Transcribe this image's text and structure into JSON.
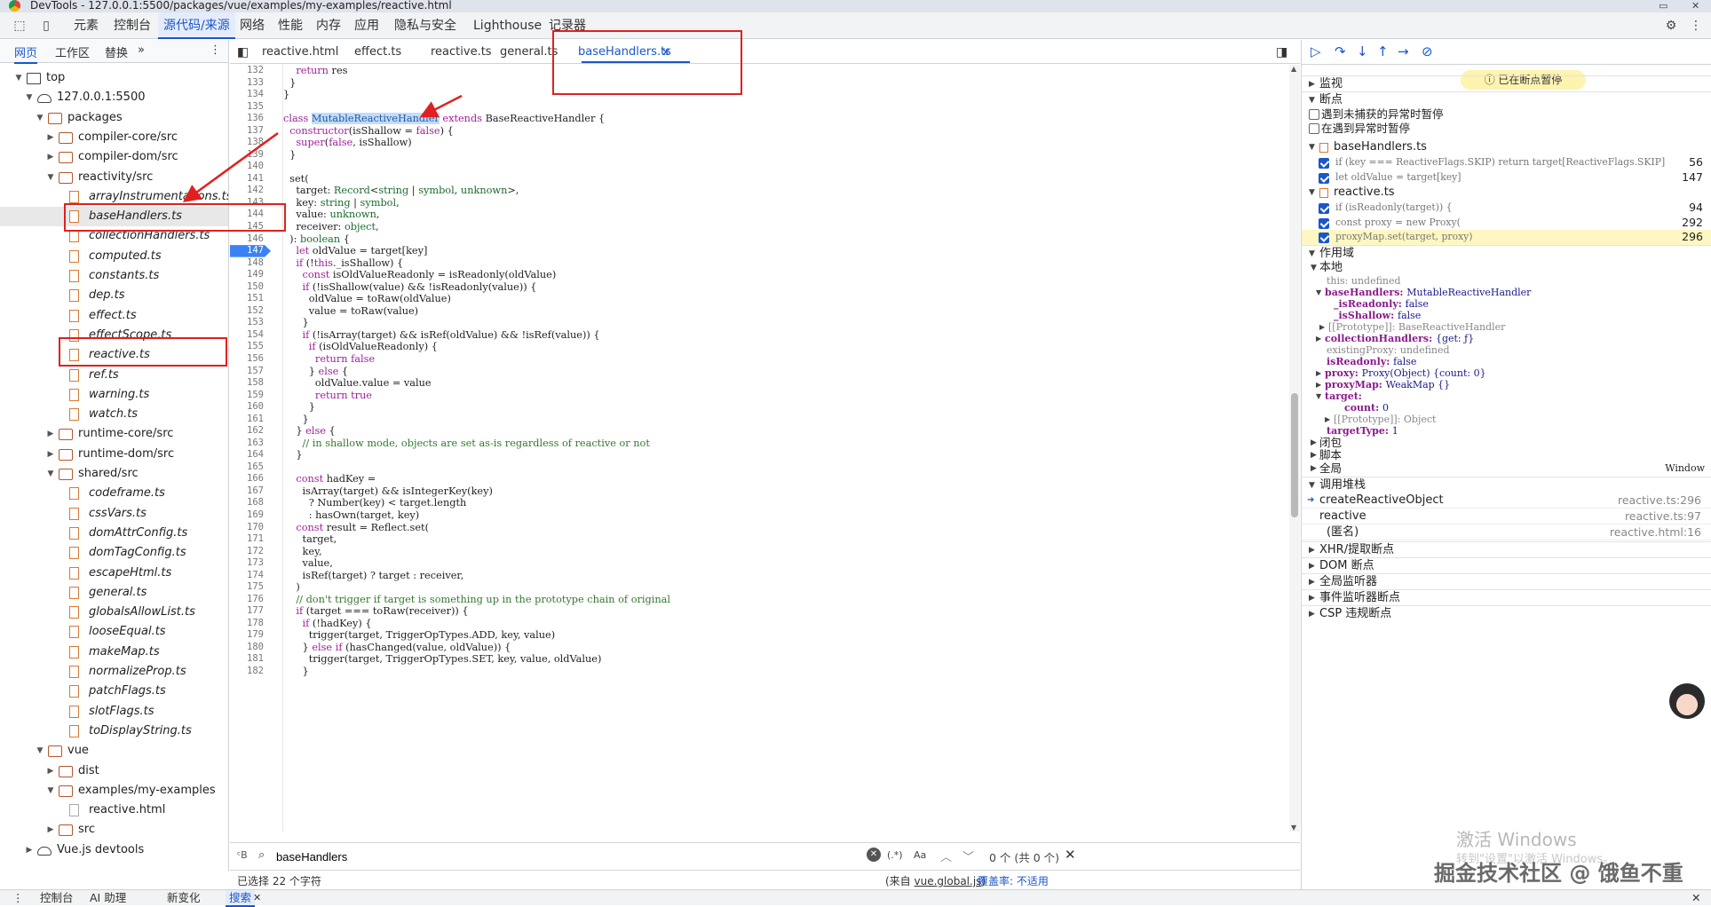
{
  "window": {
    "title": "DevTools - 127.0.0.1:5500/packages/vue/examples/my-examples/reactive.html"
  },
  "main_tabs": [
    "元素",
    "控制台",
    "源代码/来源",
    "网络",
    "性能",
    "内存",
    "应用",
    "隐私与安全",
    "Lighthouse",
    "记录器"
  ],
  "active_main_tab": "源代码/来源",
  "left_tabs": {
    "page": "网页",
    "workspace": "工作区",
    "overrides": "替换",
    "more": "»"
  },
  "file_tree": [
    {
      "label": "top",
      "depth": 0,
      "kind": "frame",
      "open": true
    },
    {
      "label": "127.0.0.1:5500",
      "depth": 1,
      "kind": "cloud",
      "open": true
    },
    {
      "label": "packages",
      "depth": 2,
      "kind": "folder",
      "open": true
    },
    {
      "label": "compiler-core/src",
      "depth": 3,
      "kind": "folder",
      "open": false
    },
    {
      "label": "compiler-dom/src",
      "depth": 3,
      "kind": "folder",
      "open": false
    },
    {
      "label": "reactivity/src",
      "depth": 3,
      "kind": "folder",
      "open": true
    },
    {
      "label": "arrayInstrumentations.ts",
      "depth": 4,
      "kind": "file"
    },
    {
      "label": "baseHandlers.ts",
      "depth": 4,
      "kind": "file",
      "selected": true
    },
    {
      "label": "collectionHandlers.ts",
      "depth": 4,
      "kind": "file"
    },
    {
      "label": "computed.ts",
      "depth": 4,
      "kind": "file"
    },
    {
      "label": "constants.ts",
      "depth": 4,
      "kind": "file"
    },
    {
      "label": "dep.ts",
      "depth": 4,
      "kind": "file"
    },
    {
      "label": "effect.ts",
      "depth": 4,
      "kind": "file"
    },
    {
      "label": "effectScope.ts",
      "depth": 4,
      "kind": "file"
    },
    {
      "label": "reactive.ts",
      "depth": 4,
      "kind": "file"
    },
    {
      "label": "ref.ts",
      "depth": 4,
      "kind": "file"
    },
    {
      "label": "warning.ts",
      "depth": 4,
      "kind": "file"
    },
    {
      "label": "watch.ts",
      "depth": 4,
      "kind": "file"
    },
    {
      "label": "runtime-core/src",
      "depth": 3,
      "kind": "folder",
      "open": false
    },
    {
      "label": "runtime-dom/src",
      "depth": 3,
      "kind": "folder",
      "open": false
    },
    {
      "label": "shared/src",
      "depth": 3,
      "kind": "folder",
      "open": true
    },
    {
      "label": "codeframe.ts",
      "depth": 4,
      "kind": "file"
    },
    {
      "label": "cssVars.ts",
      "depth": 4,
      "kind": "file"
    },
    {
      "label": "domAttrConfig.ts",
      "depth": 4,
      "kind": "file"
    },
    {
      "label": "domTagConfig.ts",
      "depth": 4,
      "kind": "file"
    },
    {
      "label": "escapeHtml.ts",
      "depth": 4,
      "kind": "file"
    },
    {
      "label": "general.ts",
      "depth": 4,
      "kind": "file"
    },
    {
      "label": "globalsAllowList.ts",
      "depth": 4,
      "kind": "file"
    },
    {
      "label": "looseEqual.ts",
      "depth": 4,
      "kind": "file"
    },
    {
      "label": "makeMap.ts",
      "depth": 4,
      "kind": "file"
    },
    {
      "label": "normalizeProp.ts",
      "depth": 4,
      "kind": "file"
    },
    {
      "label": "patchFlags.ts",
      "depth": 4,
      "kind": "file"
    },
    {
      "label": "slotFlags.ts",
      "depth": 4,
      "kind": "file"
    },
    {
      "label": "toDisplayString.ts",
      "depth": 4,
      "kind": "file"
    },
    {
      "label": "vue",
      "depth": 2,
      "kind": "folder",
      "open": true
    },
    {
      "label": "dist",
      "depth": 3,
      "kind": "folder",
      "open": false
    },
    {
      "label": "examples/my-examples",
      "depth": 3,
      "kind": "folder",
      "open": true
    },
    {
      "label": "reactive.html",
      "depth": 4,
      "kind": "htmlfile"
    },
    {
      "label": "src",
      "depth": 3,
      "kind": "folder",
      "open": false
    },
    {
      "label": "Vue.js devtools",
      "depth": 1,
      "kind": "cloud",
      "open": false
    }
  ],
  "editor_tabs": [
    "reactive.html",
    "effect.ts",
    "reactive.ts",
    "general.ts",
    "baseHandlers.ts"
  ],
  "active_editor_tab": "baseHandlers.ts",
  "code_lines": [
    {
      "n": "132",
      "t": "    return res"
    },
    {
      "n": "133",
      "t": "  }"
    },
    {
      "n": "134",
      "t": "}"
    },
    {
      "n": "135",
      "t": ""
    },
    {
      "n": "136",
      "t": "class MutableReactiveHandler extends BaseReactiveHandler {"
    },
    {
      "n": "137",
      "t": "  constructor(isShallow = false) {"
    },
    {
      "n": "138",
      "t": "    super(false, isShallow)"
    },
    {
      "n": "139",
      "t": "  }"
    },
    {
      "n": "140",
      "t": ""
    },
    {
      "n": "141",
      "t": "  set("
    },
    {
      "n": "142",
      "t": "    target: Record<string | symbol, unknown>,"
    },
    {
      "n": "143",
      "t": "    key: string | symbol,"
    },
    {
      "n": "144",
      "t": "    value: unknown,"
    },
    {
      "n": "145",
      "t": "    receiver: object,"
    },
    {
      "n": "146",
      "t": "  ): boolean {"
    },
    {
      "n": "147",
      "t": "    let oldValue = target[key]"
    },
    {
      "n": "148",
      "t": "    if (!this._isShallow) {"
    },
    {
      "n": "149",
      "t": "      const isOldValueReadonly = isReadonly(oldValue)"
    },
    {
      "n": "150",
      "t": "      if (!isShallow(value) && !isReadonly(value)) {"
    },
    {
      "n": "151",
      "t": "        oldValue = toRaw(oldValue)"
    },
    {
      "n": "152",
      "t": "        value = toRaw(value)"
    },
    {
      "n": "153",
      "t": "      }"
    },
    {
      "n": "154",
      "t": "      if (!isArray(target) && isRef(oldValue) && !isRef(value)) {"
    },
    {
      "n": "155",
      "t": "        if (isOldValueReadonly) {"
    },
    {
      "n": "156",
      "t": "          return false"
    },
    {
      "n": "157",
      "t": "        } else {"
    },
    {
      "n": "158",
      "t": "          oldValue.value = value"
    },
    {
      "n": "159",
      "t": "          return true"
    },
    {
      "n": "160",
      "t": "        }"
    },
    {
      "n": "161",
      "t": "      }"
    },
    {
      "n": "162",
      "t": "    } else {"
    },
    {
      "n": "163",
      "t": "      // in shallow mode, objects are set as-is regardless of reactive or not"
    },
    {
      "n": "164",
      "t": "    }"
    },
    {
      "n": "165",
      "t": ""
    },
    {
      "n": "166",
      "t": "    const hadKey ="
    },
    {
      "n": "167",
      "t": "      isArray(target) && isIntegerKey(key)"
    },
    {
      "n": "168",
      "t": "        ? Number(key) < target.length"
    },
    {
      "n": "169",
      "t": "        : hasOwn(target, key)"
    },
    {
      "n": "170",
      "t": "    const result = Reflect.set("
    },
    {
      "n": "171",
      "t": "      target,"
    },
    {
      "n": "172",
      "t": "      key,"
    },
    {
      "n": "173",
      "t": "      value,"
    },
    {
      "n": "174",
      "t": "      isRef(target) ? target : receiver,"
    },
    {
      "n": "175",
      "t": "    )"
    },
    {
      "n": "176",
      "t": "    // don't trigger if target is something up in the prototype chain of original"
    },
    {
      "n": "177",
      "t": "    if (target === toRaw(receiver)) {"
    },
    {
      "n": "178",
      "t": "      if (!hadKey) {"
    },
    {
      "n": "179",
      "t": "        trigger(target, TriggerOpTypes.ADD, key, value)"
    },
    {
      "n": "180",
      "t": "      } else if (hasChanged(value, oldValue)) {"
    },
    {
      "n": "181",
      "t": "        trigger(target, TriggerOpTypes.SET, key, value, oldValue)"
    },
    {
      "n": "182",
      "t": "      }"
    }
  ],
  "breakpoint_line": "147",
  "search": {
    "value": "baseHandlers",
    "regex_label": "(.*)",
    "case_label": "Aa",
    "result": "0 个 (共 0 个)"
  },
  "status": {
    "selection": "已选择 22 个字符",
    "source_prefix": "(来自 ",
    "source_link": "vue.global.js",
    "source_suffix": ")",
    "coverage": "覆盖率: 不适用"
  },
  "debugger": {
    "paused": "已在断点暂停",
    "sections": {
      "watch": "监视",
      "breakpoints": "断点",
      "scope": "作用域",
      "callstack": "调用堆栈",
      "xhr": "XHR/提取断点",
      "dom": "DOM 断点",
      "global_listeners": "全局监听器",
      "event_listeners": "事件监听器断点",
      "csp": "CSP 违规断点"
    },
    "exceptions": [
      "遇到未捕获的异常时暂停",
      "在遇到异常时暂停"
    ],
    "bp_files": [
      {
        "file": "baseHandlers.ts",
        "items": [
          {
            "code": "if (key === ReactiveFlags.SKIP) return target[ReactiveFlags.SKIP]",
            "line": "56"
          },
          {
            "code": "let oldValue = target[key]",
            "line": "147"
          }
        ]
      },
      {
        "file": "reactive.ts",
        "items": [
          {
            "code": "if (isReadonly(target)) {",
            "line": "94"
          },
          {
            "code": "const proxy = new Proxy(",
            "line": "292"
          },
          {
            "code": "proxyMap.set(target, proxy)",
            "line": "296",
            "active": true
          }
        ]
      }
    ],
    "scope": {
      "local_label": "本地",
      "rows": [
        {
          "k": "this",
          "v": "undefined",
          "dim": true
        },
        {
          "k": "baseHandlers",
          "v": "MutableReactiveHandler"
        },
        {
          "k": "_isReadonly",
          "v": "false"
        },
        {
          "k": "_isShallow",
          "v": "false"
        },
        {
          "k": "[[Prototype]]",
          "v": "BaseReactiveHandler",
          "dim": true
        },
        {
          "k": "collectionHandlers",
          "v": "{get: ƒ}"
        },
        {
          "k": "existingProxy",
          "v": "undefined",
          "dim": true
        },
        {
          "k": "isReadonly",
          "v": "false"
        },
        {
          "k": "proxy",
          "v": "Proxy(Object)  {count: 0}"
        },
        {
          "k": "proxyMap",
          "v": "WeakMap  {}"
        },
        {
          "k": "target",
          "v": ""
        },
        {
          "k": "count",
          "v": "0"
        },
        {
          "k": "[[Prototype]]",
          "v": "Object",
          "dim": true
        },
        {
          "k": "targetType",
          "v": "1"
        }
      ],
      "closure": "闭包",
      "script": "脚本",
      "global": "全局",
      "global_value": "Window"
    },
    "stack": [
      {
        "fn": "createReactiveObject",
        "loc": "reactive.ts:296",
        "current": true
      },
      {
        "fn": "reactive",
        "loc": "reactive.ts:97"
      },
      {
        "fn": "(匿名)",
        "loc": "reactive.html:16"
      }
    ]
  },
  "drawer_tabs": [
    "控制台",
    "AI 助理",
    "新变化",
    "搜索"
  ],
  "watermark": {
    "activate": "激活 Windows",
    "activate_sub": "转到\"设置\"以激活 Windows。",
    "brand": "掘金技术社区 @ 饿鱼不重"
  }
}
